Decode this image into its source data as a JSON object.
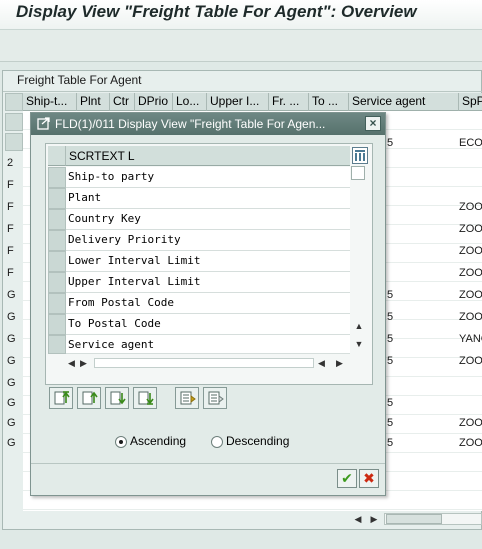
{
  "window": {
    "title": "Display View \"Freight Table For Agent\": Overview"
  },
  "table": {
    "title": "Freight Table For Agent",
    "columns": [
      "Ship-t...",
      "Plnt",
      "Ctr",
      "DPrio",
      "Lo...",
      "Upper I...",
      "Fr. ...",
      "To ...",
      "Service agent",
      "SpP"
    ],
    "row_fragments": [
      {
        "service": "5",
        "sp": "ECON"
      },
      {
        "sel": "2"
      },
      {
        "sel": "F"
      },
      {
        "sel": "F",
        "sp": "ZOO"
      },
      {
        "sel": "F",
        "sp": "ZOO"
      },
      {
        "sel": "F",
        "sp": "ZOO"
      },
      {
        "sel": "F",
        "sp": "ZOO"
      },
      {
        "sel": "G",
        "service": "5",
        "sp": "ZOO"
      },
      {
        "sel": "G",
        "service": "5",
        "sp": "ZOO"
      },
      {
        "sel": "G",
        "service": "5",
        "sp": "YANG"
      },
      {
        "sel": "G",
        "service": "5",
        "sp": "ZOO"
      },
      {
        "sel": "G"
      },
      {
        "sel": "G",
        "service": "5"
      },
      {
        "sel": "G",
        "service": "5",
        "sp": "ZOO"
      },
      {
        "sel": "G",
        "service": "5",
        "sp": "ZOO"
      }
    ]
  },
  "dialog": {
    "title": "FLD(1)/011 Display View \"Freight Table For Agen...",
    "close_label": "×",
    "list_header": "SCRTEXT L",
    "items": [
      "Ship-to party",
      "Plant",
      "Country Key",
      "Delivery Priority",
      "Lower Interval Limit",
      "Upper Interval Limit",
      "From Postal Code",
      "To Postal Code",
      "Service agent"
    ],
    "sort": {
      "ascending_label": "Ascending",
      "descending_label": "Descending",
      "selected": "ascending"
    },
    "ok_label": "✔",
    "cancel_label": "✖",
    "accent_ok": "#3c9a1d",
    "accent_cancel": "#cc2a12"
  }
}
